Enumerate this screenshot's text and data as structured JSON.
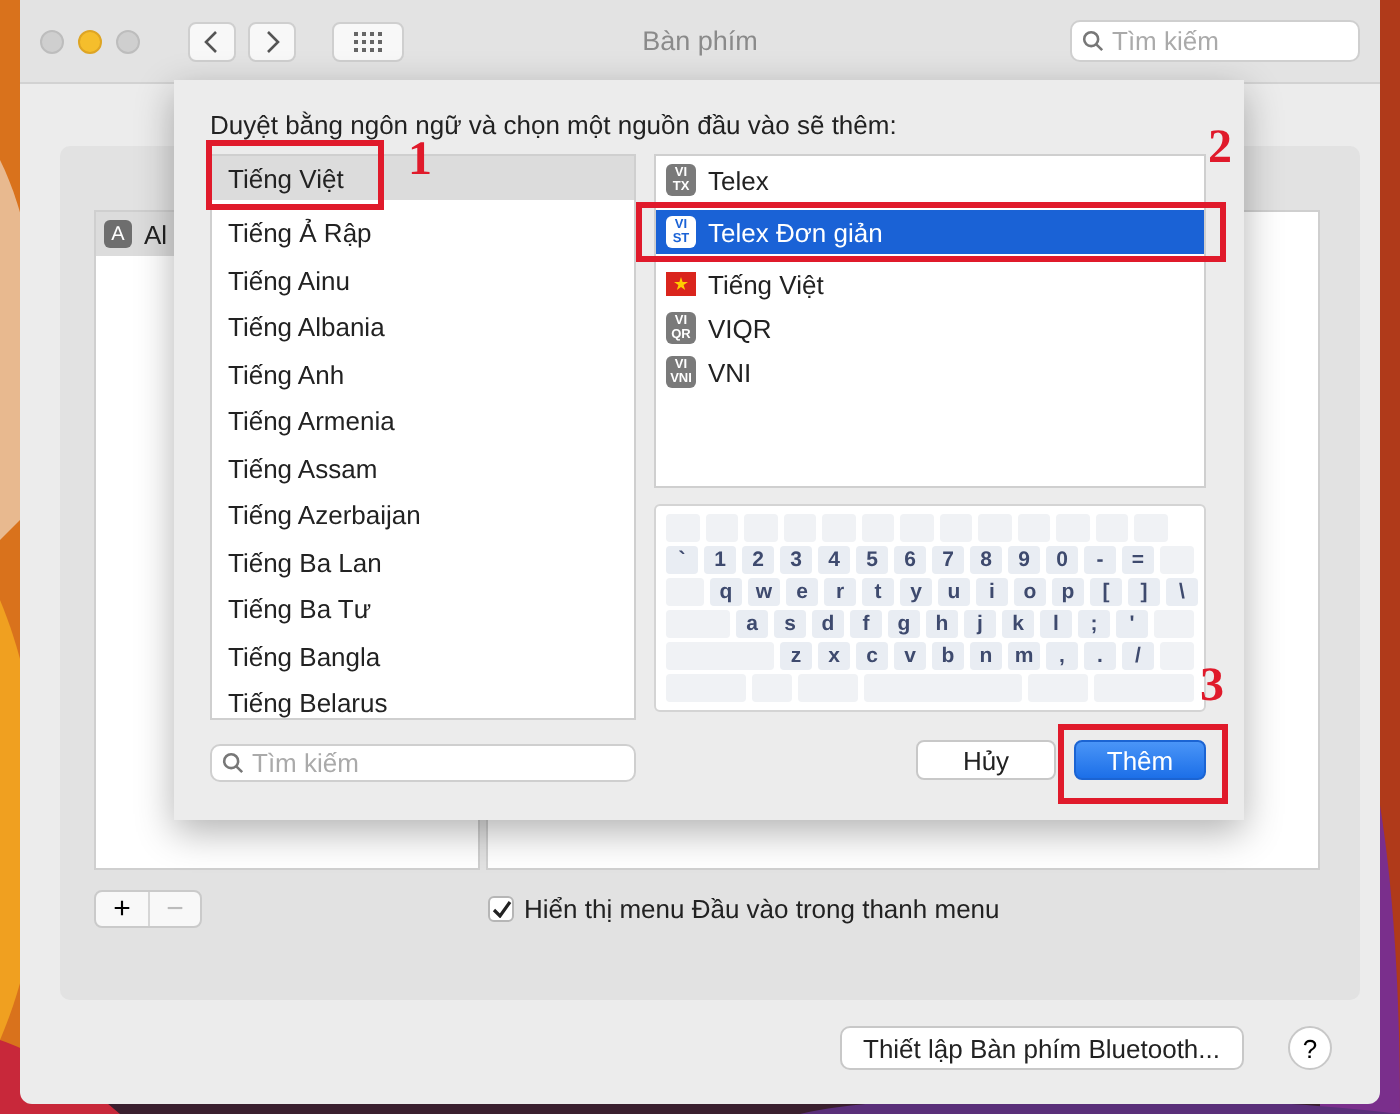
{
  "window": {
    "title": "Bàn phím",
    "search": {
      "placeholder": "Tìm kiếm"
    }
  },
  "sources_list": {
    "items": [
      {
        "badge": "A",
        "label": "Al",
        "selected": true
      }
    ]
  },
  "add_remove": {
    "add": "+",
    "remove": "−"
  },
  "show_menu_checkbox": {
    "label": "Hiển thị menu Đầu vào trong thanh menu",
    "checked": true
  },
  "bluetooth_button": "Thiết lập Bàn phím Bluetooth...",
  "help_button": "?",
  "sheet": {
    "heading": "Duyệt bằng ngôn ngữ và chọn một nguồn đầu vào sẽ thêm:",
    "languages": [
      {
        "label": "Tiếng Việt",
        "selected": true
      },
      {
        "label": "Tiếng Ả Rập",
        "selected": false
      },
      {
        "label": "Tiếng Ainu",
        "selected": false
      },
      {
        "label": "Tiếng Albania",
        "selected": false
      },
      {
        "label": "Tiếng Anh",
        "selected": false
      },
      {
        "label": "Tiếng Armenia",
        "selected": false
      },
      {
        "label": "Tiếng Assam",
        "selected": false
      },
      {
        "label": "Tiếng Azerbaijan",
        "selected": false
      },
      {
        "label": "Tiếng Ba Lan",
        "selected": false
      },
      {
        "label": "Tiếng Ba Tư",
        "selected": false
      },
      {
        "label": "Tiếng Bangla",
        "selected": false
      },
      {
        "label": "Tiếng Belarus",
        "selected": false
      }
    ],
    "search": {
      "placeholder": "Tìm kiếm"
    },
    "input_sources": [
      {
        "kind": "badge",
        "badge_top": "VI",
        "badge_bottom": "TX",
        "label": "Telex",
        "selected": false
      },
      {
        "kind": "badge",
        "badge_top": "VI",
        "badge_bottom": "ST",
        "label": "Telex Đơn giản",
        "selected": true
      },
      {
        "kind": "flag",
        "label": "Tiếng Việt",
        "selected": false
      },
      {
        "kind": "badge",
        "badge_top": "VI",
        "badge_bottom": "QR",
        "label": "VIQR",
        "selected": false
      },
      {
        "kind": "badge",
        "badge_top": "VI",
        "badge_bottom": "VNI",
        "label": "VNI",
        "selected": false
      }
    ],
    "keyboard_rows": [
      [
        "`",
        "1",
        "2",
        "3",
        "4",
        "5",
        "6",
        "7",
        "8",
        "9",
        "0",
        "-",
        "="
      ],
      [
        "q",
        "w",
        "e",
        "r",
        "t",
        "y",
        "u",
        "i",
        "o",
        "p",
        "[",
        "]",
        "\\"
      ],
      [
        "a",
        "s",
        "d",
        "f",
        "g",
        "h",
        "j",
        "k",
        "l",
        ";",
        "'"
      ],
      [
        "z",
        "x",
        "c",
        "v",
        "b",
        "n",
        "m",
        ",",
        ".",
        "/"
      ]
    ],
    "cancel_button": "Hủy",
    "add_button": "Thêm"
  },
  "annotations": [
    {
      "number": "1"
    },
    {
      "number": "2"
    },
    {
      "number": "3"
    }
  ]
}
